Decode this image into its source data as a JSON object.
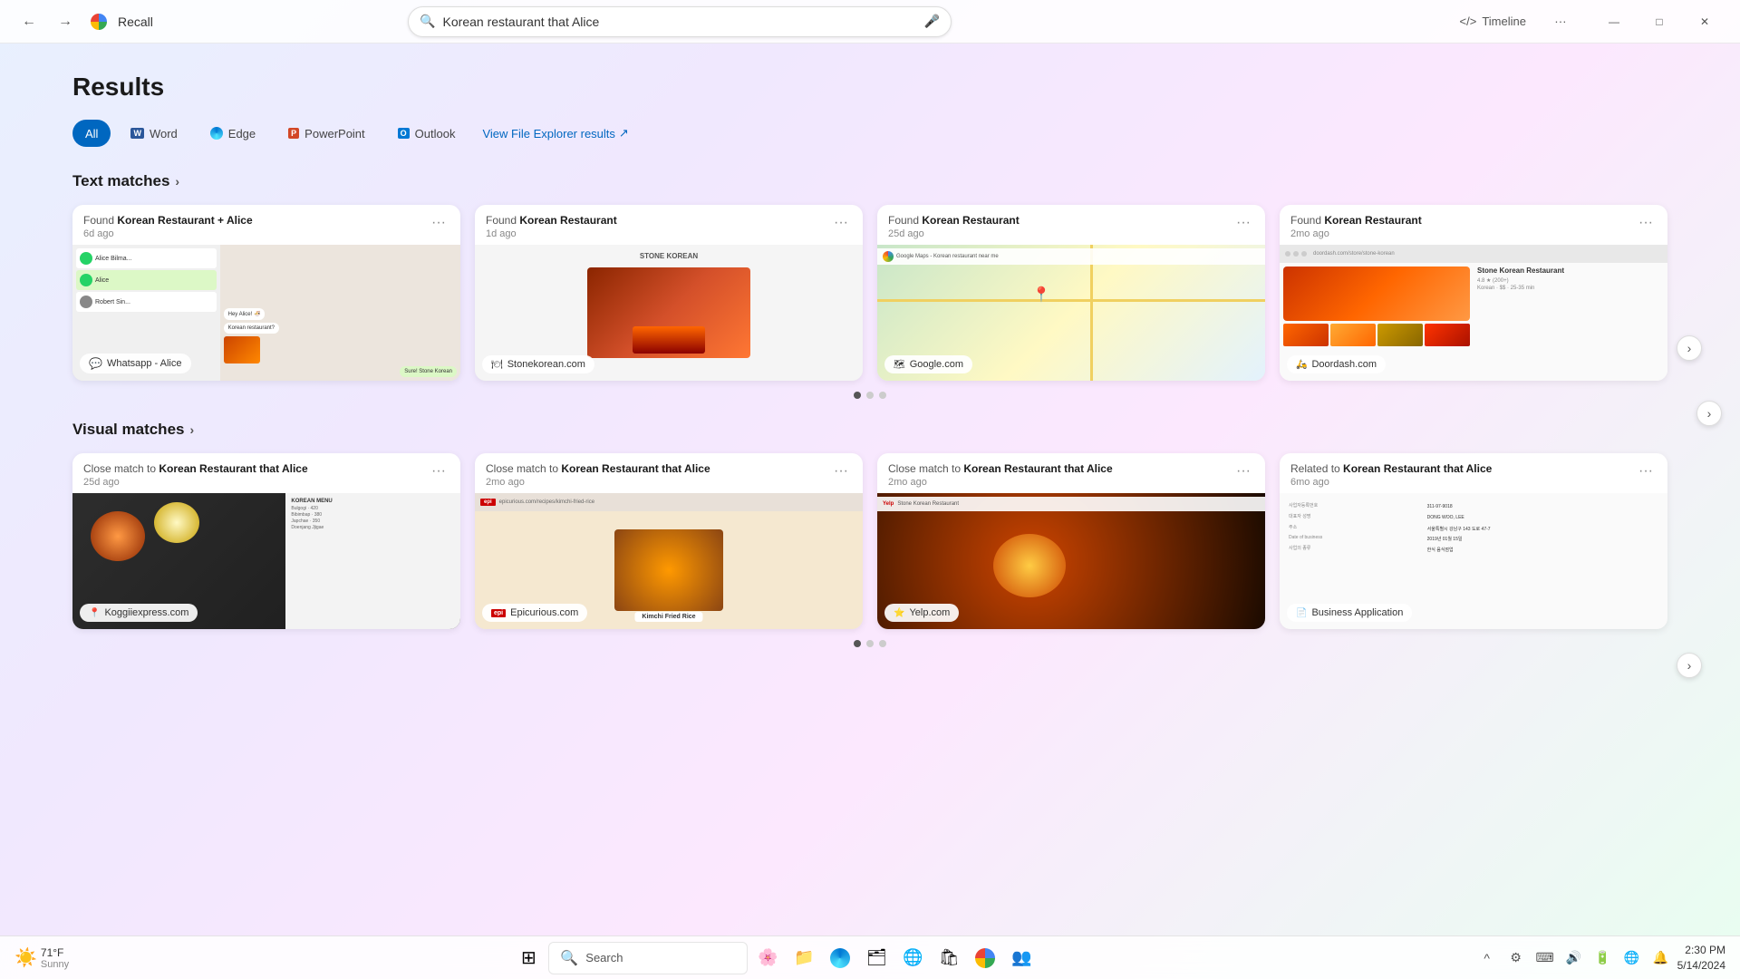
{
  "app": {
    "name": "Recall",
    "title": "Results"
  },
  "titlebar": {
    "back_label": "←",
    "forward_label": "→",
    "more_label": "···",
    "timeline_label": "Timeline",
    "minimize_label": "—",
    "maximize_label": "□",
    "close_label": "✕"
  },
  "search": {
    "value": "Korean restaurant that Alice",
    "placeholder": "Korean restaurant that Alice"
  },
  "filters": {
    "all_label": "All",
    "word_label": "Word",
    "edge_label": "Edge",
    "powerpoint_label": "PowerPoint",
    "outlook_label": "Outlook",
    "view_explorer_label": "View File Explorer results"
  },
  "text_matches": {
    "section_label": "Text matches",
    "chevron": "›",
    "cards": [
      {
        "found_prefix": "Found ",
        "found_term": "Korean Restaurant + Alice",
        "time": "6d ago",
        "source": "Whatsapp - Alice",
        "source_color": "#25d366"
      },
      {
        "found_prefix": "Found ",
        "found_term": "Korean Restaurant",
        "time": "1d ago",
        "source": "Stonekorean.com",
        "source_color": "#888888"
      },
      {
        "found_prefix": "Found ",
        "found_term": "Korean Restaurant",
        "time": "25d ago",
        "source": "Google.com",
        "source_color": "#4285f4"
      },
      {
        "found_prefix": "Found ",
        "found_term": "Korean Restaurant",
        "time": "2mo ago",
        "source": "Doordash.com",
        "source_color": "#ff3008"
      }
    ],
    "carousel_dots": [
      true,
      false,
      false
    ]
  },
  "visual_matches": {
    "section_label": "Visual matches",
    "chevron": "›",
    "cards": [
      {
        "found_prefix": "Close match to ",
        "found_term": "Korean Restaurant that Alice",
        "time": "25d ago",
        "source": "Koggiiexpress.com",
        "source_color": "#cc3300"
      },
      {
        "found_prefix": "Close match to ",
        "found_term": "Korean Restaurant that Alice",
        "time": "2mo ago",
        "source": "Epicurious.com",
        "source_color": "#cc0000"
      },
      {
        "found_prefix": "Close match to ",
        "found_term": "Korean Restaurant that Alice",
        "time": "2mo ago",
        "source": "Yelp.com",
        "source_color": "#cc0000"
      },
      {
        "found_prefix": "Related to ",
        "found_term": "Korean Restaurant that Alice",
        "time": "6mo ago",
        "source": "Business Application",
        "source_color": "#ff6600"
      }
    ],
    "carousel_dots": [
      true,
      false,
      false
    ]
  },
  "taskbar": {
    "weather_temp": "71°F",
    "weather_condition": "Sunny",
    "search_label": "Search",
    "time": "2:30 PM",
    "date": "5/14/2024"
  },
  "icons": {
    "search": "🔍",
    "mic": "🎤",
    "code": "</>",
    "menu_dots": "•••",
    "chevron_right": "›",
    "windows": "⊞",
    "notification": "🔔",
    "wifi": "WiFi",
    "volume": "🔊",
    "battery": "🔋",
    "arrow_left": "‹",
    "arrow_right": "›"
  }
}
